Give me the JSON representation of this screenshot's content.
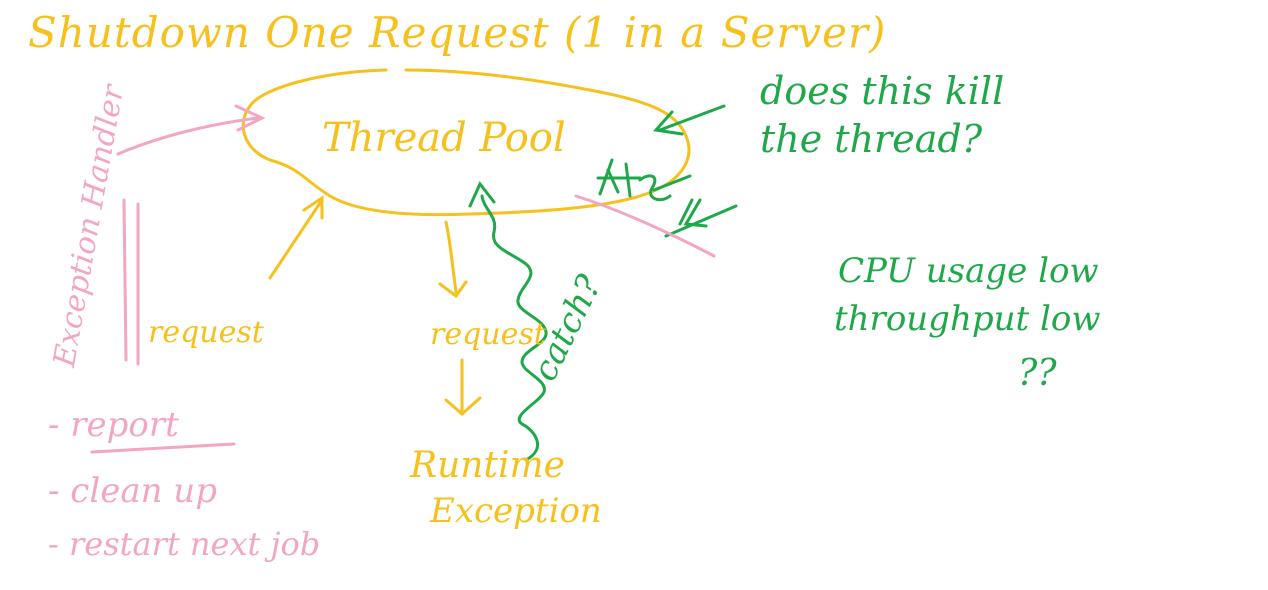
{
  "diagram": {
    "title": "Shutdown One Request (1 in a Server)",
    "thread_pool_label": "Thread Pool",
    "question_kill": [
      "does this kill",
      "the thread?"
    ],
    "cpu_note": [
      "CPU usage low",
      "throughput low"
    ],
    "cpu_question": "??",
    "catch_label": "catch?",
    "request_left_label": "request",
    "request_mid_label": "request",
    "runtime_exception": [
      "Runtime",
      "Exception"
    ],
    "exception_handler_label": "Exception Handler",
    "handler_steps": [
      "- report",
      "- clean up",
      "- restart next job"
    ],
    "crossed_marks": [
      "If",
      "is",
      "If"
    ]
  },
  "colors": {
    "yellow": "#f6c11d",
    "green": "#1fa84a",
    "pink": "#f2a6c4",
    "background": "#ffffff"
  }
}
